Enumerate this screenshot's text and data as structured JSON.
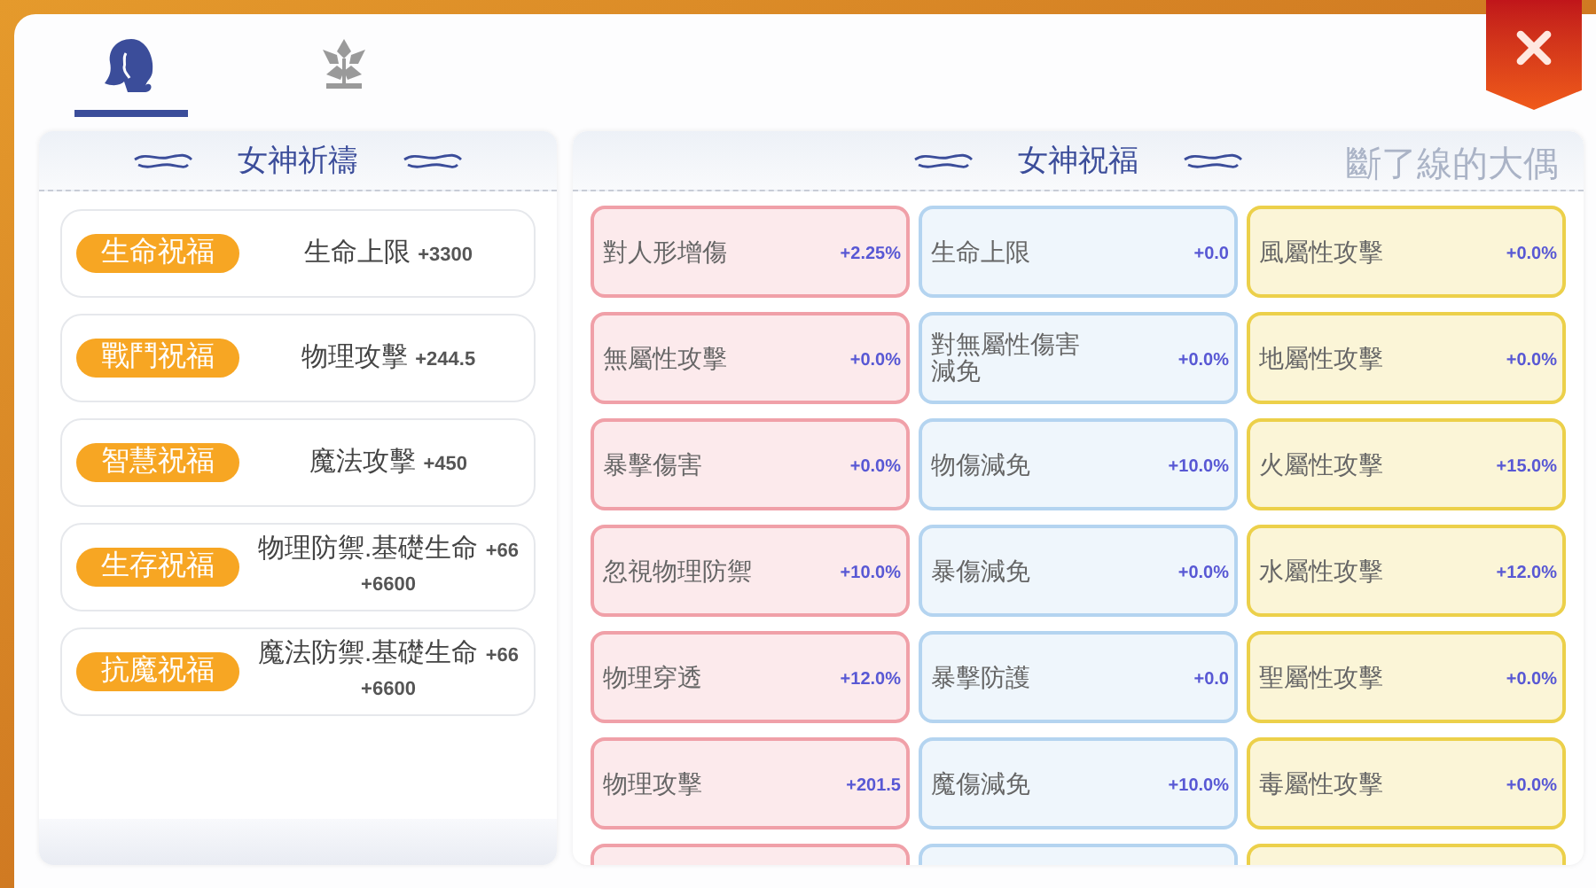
{
  "tabs": [
    {
      "kind": "goddess",
      "selected": true
    },
    {
      "kind": "emblem",
      "selected": false
    }
  ],
  "prayer_panel": {
    "title": "女神祈禱",
    "items": [
      {
        "badge": "生命祝福",
        "stat": "生命上限",
        "value": "+3300"
      },
      {
        "badge": "戰鬥祝福",
        "stat": "物理攻擊",
        "value": "+244.5"
      },
      {
        "badge": "智慧祝福",
        "stat": "魔法攻擊",
        "value": "+450"
      },
      {
        "badge": "生存祝福",
        "stat": "物理防禦.基礎生命",
        "value": "+66 +6600"
      },
      {
        "badge": "抗魔祝福",
        "stat": "魔法防禦.基礎生命",
        "value": "+66 +6600"
      }
    ]
  },
  "blessing_panel": {
    "title": "女神祝福",
    "overlay_text": "斷了線的大偶",
    "columns": [
      {
        "color": "#f0a0a8",
        "items": [
          {
            "label": "對人形增傷",
            "value": "+2.25%"
          },
          {
            "label": "無屬性攻擊",
            "value": "+0.0%"
          },
          {
            "label": "暴擊傷害",
            "value": "+0.0%"
          },
          {
            "label": "忽視物理防禦",
            "value": "+10.0%"
          },
          {
            "label": "物理穿透",
            "value": "+12.0%"
          },
          {
            "label": "物理攻擊",
            "value": "+201.5"
          }
        ]
      },
      {
        "color": "#b4d4f0",
        "items": [
          {
            "label": "生命上限",
            "value": "+0.0"
          },
          {
            "label": "對無屬性傷害減免",
            "value": "+0.0%"
          },
          {
            "label": "物傷減免",
            "value": "+10.0%"
          },
          {
            "label": "暴傷減免",
            "value": "+0.0%"
          },
          {
            "label": "暴擊防護",
            "value": "+0.0"
          },
          {
            "label": "魔傷減免",
            "value": "+10.0%"
          }
        ]
      },
      {
        "color": "#ecd04a",
        "items": [
          {
            "label": "風屬性攻擊",
            "value": "+0.0%"
          },
          {
            "label": "地屬性攻擊",
            "value": "+0.0%"
          },
          {
            "label": "火屬性攻擊",
            "value": "+15.0%"
          },
          {
            "label": "水屬性攻擊",
            "value": "+12.0%"
          },
          {
            "label": "聖屬性攻擊",
            "value": "+0.0%"
          },
          {
            "label": "毒屬性攻擊",
            "value": "+0.0%"
          }
        ]
      }
    ]
  }
}
